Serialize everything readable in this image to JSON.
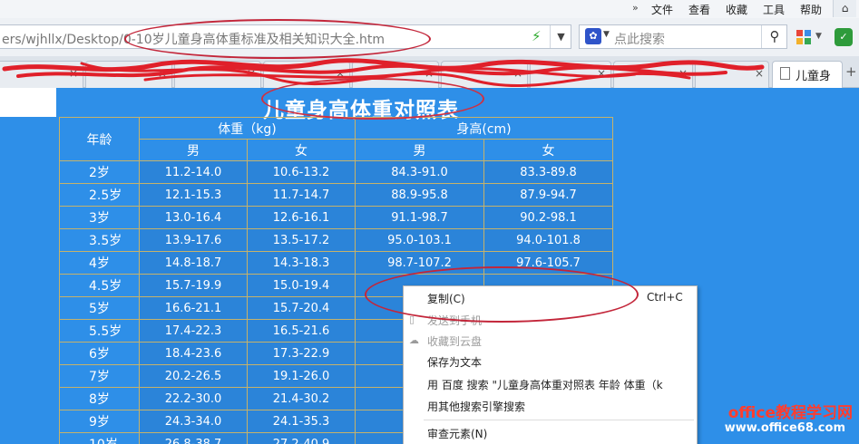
{
  "menubar": {
    "items": [
      "文件",
      "查看",
      "收藏",
      "工具",
      "帮助"
    ],
    "chevron": "»",
    "home_icon": "home-icon"
  },
  "address": {
    "url": "ers/wjhllx/Desktop/0-10岁儿童身高体重标准及相关知识大全.htm",
    "go_icon": "lightning-icon"
  },
  "search": {
    "placeholder": "点此搜索",
    "engine_icon": "baidu-paw-icon"
  },
  "tabs": {
    "active_label": "儿童身",
    "close_glyph": "×",
    "add_glyph": "+"
  },
  "page": {
    "title": "儿童身高体重对照表"
  },
  "table": {
    "header": {
      "age": "年龄",
      "weight": "体重（kg)",
      "height": "身高(cm)",
      "male": "男",
      "female": "女"
    },
    "rows": [
      {
        "age": "2岁",
        "w_m": "11.2-14.0",
        "w_f": "10.6-13.2",
        "h_m": "84.3-91.0",
        "h_f": "83.3-89.8"
      },
      {
        "age": "2.5岁",
        "w_m": "12.1-15.3",
        "w_f": "11.7-14.7",
        "h_m": "88.9-95.8",
        "h_f": "87.9-94.7"
      },
      {
        "age": "3岁",
        "w_m": "13.0-16.4",
        "w_f": "12.6-16.1",
        "h_m": "91.1-98.7",
        "h_f": "90.2-98.1"
      },
      {
        "age": "3.5岁",
        "w_m": "13.9-17.6",
        "w_f": "13.5-17.2",
        "h_m": "95.0-103.1",
        "h_f": "94.0-101.8"
      },
      {
        "age": "4岁",
        "w_m": "14.8-18.7",
        "w_f": "14.3-18.3",
        "h_m": "98.7-107.2",
        "h_f": "97.6-105.7"
      },
      {
        "age": "4.5岁",
        "w_m": "15.7-19.9",
        "w_f": "15.0-19.4",
        "h_m": "",
        "h_f": ""
      },
      {
        "age": "5岁",
        "w_m": "16.6-21.1",
        "w_f": "15.7-20.4",
        "h_m": "",
        "h_f": ""
      },
      {
        "age": "5.5岁",
        "w_m": "17.4-22.3",
        "w_f": "16.5-21.6",
        "h_m": "",
        "h_f": ""
      },
      {
        "age": "6岁",
        "w_m": "18.4-23.6",
        "w_f": "17.3-22.9",
        "h_m": "",
        "h_f": ""
      },
      {
        "age": "7岁",
        "w_m": "20.2-26.5",
        "w_f": "19.1-26.0",
        "h_m": "",
        "h_f": ""
      },
      {
        "age": "8岁",
        "w_m": "22.2-30.0",
        "w_f": "21.4-30.2",
        "h_m": "",
        "h_f": ""
      },
      {
        "age": "9岁",
        "w_m": "24.3-34.0",
        "w_f": "24.1-35.3",
        "h_m": "",
        "h_f": ""
      },
      {
        "age": "10岁",
        "w_m": "26.8-38.7",
        "w_f": "27.2-40.9",
        "h_m": "",
        "h_f": ""
      }
    ]
  },
  "context_menu": {
    "copy": {
      "label": "复制(C)",
      "shortcut": "Ctrl+C"
    },
    "send_to_phone": {
      "label": "发送到手机",
      "disabled": true
    },
    "save_cloud": {
      "label": "收藏到云盘",
      "disabled": true
    },
    "save_text": {
      "label": "保存为文本"
    },
    "baidu_search": {
      "label": "用 百度 搜索 \"儿童身高体重对照表 年龄 体重（k"
    },
    "other_search": {
      "label": "用其他搜索引擎搜索"
    },
    "inspect": {
      "label": "审查元素(N)"
    }
  },
  "watermark": {
    "line1": "office教程学习网",
    "line2": "www.office68.com"
  },
  "colors": {
    "page_bg": "#2e8fe8",
    "cell_bg": "#2b84d9",
    "grid": "#c6b26a",
    "annotation": "#c3263a",
    "watermark_red": "#ff3d2e"
  }
}
